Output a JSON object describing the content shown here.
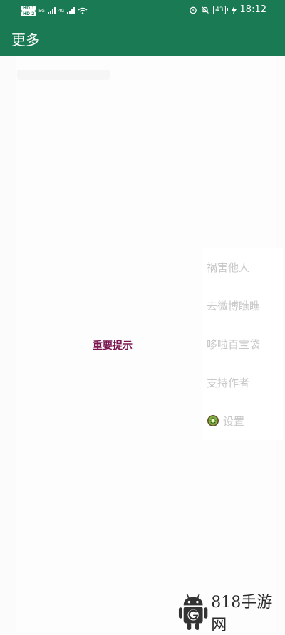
{
  "status_bar": {
    "sim1_badge": "HD 1",
    "sim2_badge": "HD 2",
    "net1": "5G",
    "net2": "4G",
    "battery_level": "43",
    "time": "18:12"
  },
  "app_bar": {
    "title": "更多"
  },
  "main": {
    "notice_link": "重要提示"
  },
  "menu": {
    "items": [
      {
        "label": "祸害他人"
      },
      {
        "label": "去微博瞧瞧"
      },
      {
        "label": "哆啦百宝袋"
      },
      {
        "label": "支持作者"
      },
      {
        "label": "设置",
        "icon": "kiwi-icon"
      }
    ]
  },
  "watermark": {
    "text": "818手游网"
  },
  "colors": {
    "accent": "#1a7a54",
    "link": "#7a1650",
    "menu_text": "#c8c8c8"
  }
}
